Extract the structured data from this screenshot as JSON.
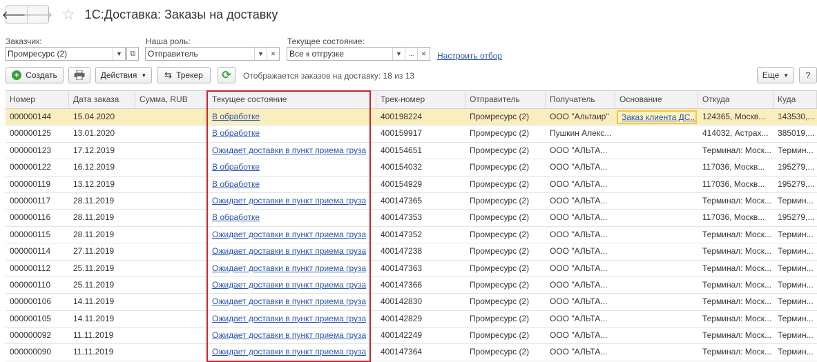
{
  "window": {
    "back_icon": "arrow-left-icon",
    "forward_icon": "arrow-right-icon",
    "favorite_icon": "star-icon",
    "title": "1С:Доставка: Заказы на доставку"
  },
  "filters": {
    "customer": {
      "label": "Заказчик:",
      "value": "Промресурс (2)"
    },
    "role": {
      "label": "Наша роль:",
      "value": "Отправитель"
    },
    "state": {
      "label": "Текущее состояние:",
      "value": "Все к отгрузке"
    },
    "setup_link": "Настроить отбор"
  },
  "toolbar": {
    "create": "Создать",
    "actions": "Действия",
    "tracker": "Трекер",
    "shown_text": "Отображается заказов на доставку: 18 из 13",
    "more": "Еще",
    "help": "?"
  },
  "table": {
    "columns": [
      "Номер",
      "Дата заказа",
      "Сумма, RUB",
      "Текущее состояние",
      "Трек-номер",
      "Отправитель",
      "Получатель",
      "Основание",
      "Откуда",
      "Куда"
    ],
    "rows": [
      [
        "000000144",
        "15.04.2020",
        "",
        "В обработке",
        "400198224",
        "Промресурс (2)",
        "ООО \"Альтаир\"",
        "Заказ клиента ДС...",
        "124365, Москв...",
        "143530,..."
      ],
      [
        "000000125",
        "13.01.2020",
        "",
        "В обработке",
        "400159917",
        "Промресурс (2)",
        "Пушкин Алекс...",
        "",
        "414032, Астрах...",
        "385019,..."
      ],
      [
        "000000123",
        "17.12.2019",
        "",
        "Ожидает доставки в пункт приема груза",
        "400154651",
        "Промресурс (2)",
        "ООО \"АЛЬТА...",
        "",
        "Терминал: Моск...",
        "Термин..."
      ],
      [
        "000000122",
        "16.12.2019",
        "",
        "В обработке",
        "400154032",
        "Промресурс (2)",
        "ООО \"АЛЬТА...",
        "",
        "117036, Москв...",
        "195279,..."
      ],
      [
        "000000119",
        "13.12.2019",
        "",
        "В обработке",
        "400154929",
        "Промресурс (2)",
        "ООО \"АЛЬТА...",
        "",
        "117036, Москв...",
        "195279,..."
      ],
      [
        "000000117",
        "28.11.2019",
        "",
        "Ожидает доставки в пункт приема груза",
        "400147365",
        "Промресурс (2)",
        "ООО \"АЛЬТА...",
        "",
        "Терминал: Моск...",
        "Термин..."
      ],
      [
        "000000116",
        "28.11.2019",
        "",
        "В обработке",
        "400147353",
        "Промресурс (2)",
        "ООО \"АЛЬТА...",
        "",
        "117036, Москв...",
        "195279,..."
      ],
      [
        "000000115",
        "28.11.2019",
        "",
        "Ожидает доставки в пункт приема груза",
        "400147352",
        "Промресурс (2)",
        "ООО \"АЛЬТА...",
        "",
        "Терминал: Моск...",
        "Термин..."
      ],
      [
        "000000114",
        "27.11.2019",
        "",
        "Ожидает доставки в пункт приема груза",
        "400147238",
        "Промресурс (2)",
        "ООО \"АЛЬТА...",
        "",
        "Терминал: Моск...",
        "Термин..."
      ],
      [
        "000000112",
        "25.11.2019",
        "",
        "Ожидает доставки в пункт приема груза",
        "400147363",
        "Промресурс (2)",
        "ООО \"АЛЬТА...",
        "",
        "Терминал: Моск...",
        "Термин..."
      ],
      [
        "000000110",
        "25.11.2019",
        "",
        "Ожидает доставки в пункт приема груза",
        "400147366",
        "Промресурс (2)",
        "ООО \"АЛЬТА...",
        "",
        "Терминал: Моск...",
        "Термин..."
      ],
      [
        "000000106",
        "14.11.2019",
        "",
        "Ожидает доставки в пункт приема груза",
        "400142830",
        "Промресурс (2)",
        "ООО \"АЛЬТА...",
        "",
        "Терминал: Моск...",
        "Термин..."
      ],
      [
        "000000105",
        "14.11.2019",
        "",
        "Ожидает доставки в пункт приема груза",
        "400142829",
        "Промресурс (2)",
        "ООО \"АЛЬТА...",
        "",
        "Терминал: Моск...",
        "Термин..."
      ],
      [
        "000000092",
        "11.11.2019",
        "",
        "Ожидает доставки в пункт приема груза",
        "400142249",
        "Промресурс (2)",
        "ООО \"АЛЬТА...",
        "",
        "Терминал: Моск...",
        "Термин..."
      ],
      [
        "000000090",
        "11.11.2019",
        "",
        "Ожидает доставки в пункт приема груза",
        "400147364",
        "Промресурс (2)",
        "ООО \"АЛЬТА...",
        "",
        "Терминал: Моск...",
        "Термин..."
      ]
    ]
  },
  "colors": {
    "link": "#2a55b0",
    "selected_row": "#fbeebe",
    "highlight_frame": "#d0202a"
  }
}
